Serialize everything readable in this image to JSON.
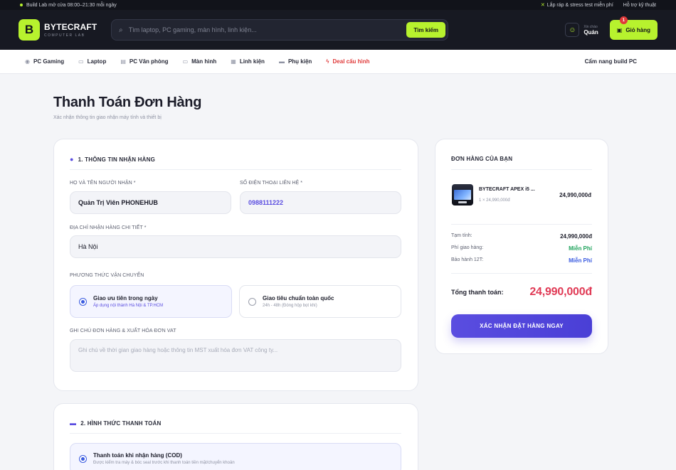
{
  "topbar": {
    "hours": "Build Lab mở cửa 08:00–21:30 mỗi ngày",
    "promo": "Lắp ráp & stress test miễn phí",
    "support": "Hỗ trợ kỹ thuật"
  },
  "header": {
    "logo_letter": "B",
    "brand": "BYTECRAFT",
    "brand_sub": "COMPUTER LAB",
    "search_placeholder": "Tìm laptop, PC gaming, màn hình, linh kiện...",
    "search_button": "Tìm kiếm",
    "account_greeting": "Xin chào",
    "account_name": "Quản",
    "cart_label": "Giỏ hàng",
    "cart_count": "1"
  },
  "nav": {
    "items": [
      {
        "label": "PC Gaming",
        "icon": "gamepad-icon"
      },
      {
        "label": "Laptop",
        "icon": "laptop-icon"
      },
      {
        "label": "PC Văn phòng",
        "icon": "briefcase-icon"
      },
      {
        "label": "Màn hình",
        "icon": "monitor-icon"
      },
      {
        "label": "Linh kiện",
        "icon": "chip-icon"
      },
      {
        "label": "Phụ kiện",
        "icon": "keyboard-icon"
      },
      {
        "label": "Deal cấu hình",
        "icon": "bolt-icon"
      }
    ],
    "right_link": "Cẩm nang build PC"
  },
  "page": {
    "title": "Thanh Toán Đơn Hàng",
    "subtitle": "Xác nhận thông tin giao nhận máy tính và thiết bị"
  },
  "shipping": {
    "section_title": "1. THÔNG TIN NHẬN HÀNG",
    "name_label": "HỌ VÀ TÊN NGƯỜI NHẬN *",
    "name_value": "Quản Trị Viên PHONEHUB",
    "phone_label": "SỐ ĐIỆN THOẠI LIÊN HỆ *",
    "phone_value": "0988111222",
    "address_label": "ĐỊA CHỈ NHẬN HÀNG CHI TIẾT *",
    "address_value": "Hà Nội",
    "method_label": "PHƯƠNG THỨC VẬN CHUYỂN",
    "methods": [
      {
        "title": "Giao ưu tiên trong ngày",
        "desc": "Áp dụng nội thành Hà Nội & TP.HCM",
        "selected": true
      },
      {
        "title": "Giao tiêu chuẩn toàn quốc",
        "desc": "24h - 48h (Đóng hộp bọt khí)",
        "selected": false
      }
    ],
    "note_label": "GHI CHÚ ĐƠN HÀNG & XUẤT HÓA ĐƠN VAT",
    "note_placeholder": "Ghi chú về thời gian giao hàng hoặc thông tin MST xuất hóa đơn VAT công ty..."
  },
  "payment": {
    "section_title": "2. HÌNH THỨC THANH TOÁN",
    "option_title": "Thanh toán khi nhận hàng (COD)",
    "option_desc": "Được kiểm tra máy & bóc seal trước khi thanh toán tiền mặt/chuyển khoản"
  },
  "order": {
    "title": "ĐƠN HÀNG CỦA BẠN",
    "product_name": "BYTECRAFT APEX i5 ...",
    "product_qty": "1 × 24,990,000đ",
    "product_price": "24,990,000đ",
    "subtotal_label": "Tạm tính:",
    "subtotal_value": "24,990,000đ",
    "shipping_label": "Phí giao hàng:",
    "shipping_value": "Miễn Phí",
    "warranty_label": "Bảo hành 12T:",
    "warranty_value": "Miễn Phí",
    "total_label": "Tổng thanh toán:",
    "total_value": "24,990,000đ",
    "confirm_button": "XÁC NHẬN ĐẶT HÀNG NGAY"
  },
  "colors": {
    "brand_accent": "#b7f22e",
    "primary": "#5a4de0",
    "total_price": "#e03a55",
    "free_green": "#1fa35c"
  }
}
